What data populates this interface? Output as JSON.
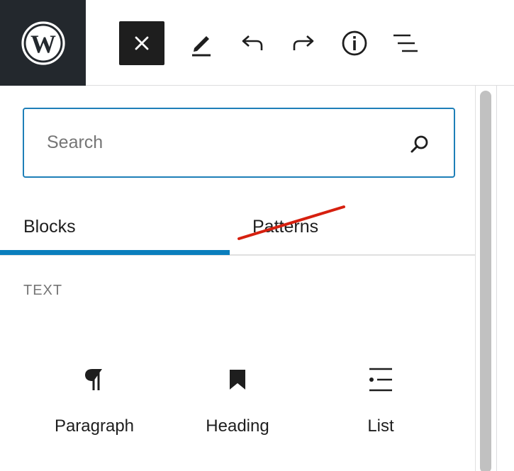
{
  "toolbar": {
    "logo_icon": "wordpress-logo-icon",
    "buttons": [
      {
        "name": "close-inserter",
        "icon": "close-icon",
        "active": true
      },
      {
        "name": "tools",
        "icon": "pencil-icon"
      },
      {
        "name": "undo",
        "icon": "undo-icon"
      },
      {
        "name": "redo",
        "icon": "redo-icon"
      },
      {
        "name": "details",
        "icon": "info-icon"
      },
      {
        "name": "list-view",
        "icon": "list-view-icon"
      }
    ]
  },
  "inserter": {
    "search": {
      "placeholder": "Search",
      "value": "",
      "icon": "search-icon"
    },
    "tabs": [
      {
        "label": "Blocks",
        "selected": true
      },
      {
        "label": "Patterns",
        "selected": false,
        "annotation": "red-strikethrough"
      }
    ],
    "section_title": "TEXT",
    "blocks": [
      {
        "label": "Paragraph",
        "icon": "paragraph-icon"
      },
      {
        "label": "Heading",
        "icon": "bookmark-icon"
      },
      {
        "label": "List",
        "icon": "list-icon"
      }
    ]
  },
  "colors": {
    "logo_background": "#23282d",
    "accent": "#0a7ebd",
    "search_border": "#1e7fb8",
    "strike": "#d6200f",
    "muted_text": "#757575"
  }
}
